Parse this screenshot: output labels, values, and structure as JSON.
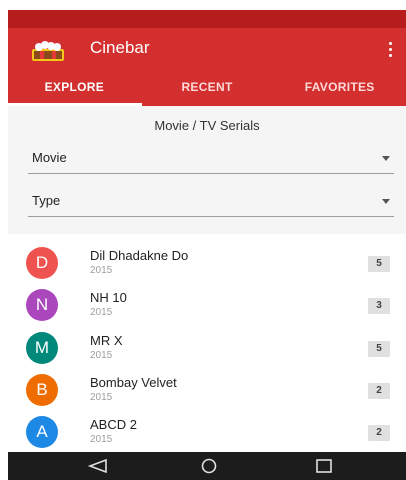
{
  "app": {
    "title": "Cinebar",
    "logo_icon": "cinema-popcorn-logo",
    "colors": {
      "primary": "#d32f2f",
      "statusbar": "#b71c1c",
      "navbar": "#1c1c1c"
    }
  },
  "tabs": [
    {
      "label": "EXPLORE",
      "active": true
    },
    {
      "label": "RECENT",
      "active": false
    },
    {
      "label": "FAVORITES",
      "active": false
    }
  ],
  "filters": {
    "title": "Movie / TV Serials",
    "category": {
      "value": "Movie"
    },
    "type": {
      "value": "Type"
    }
  },
  "items": [
    {
      "initial": "D",
      "color": "#ef5350",
      "title": "Dil Dhadakne Do",
      "year": "2015",
      "count": "5"
    },
    {
      "initial": "N",
      "color": "#ab47bc",
      "title": "NH 10",
      "year": "2015",
      "count": "3"
    },
    {
      "initial": "M",
      "color": "#00897b",
      "title": "MR X",
      "year": "2015",
      "count": "5"
    },
    {
      "initial": "B",
      "color": "#ef6c00",
      "title": "Bombay Velvet",
      "year": "2015",
      "count": "2"
    },
    {
      "initial": "A",
      "color": "#1e88e5",
      "title": "ABCD 2",
      "year": "2015",
      "count": "2"
    }
  ],
  "navbar": {
    "back_icon": "back-icon",
    "home_icon": "home-icon",
    "recents_icon": "recents-icon"
  }
}
